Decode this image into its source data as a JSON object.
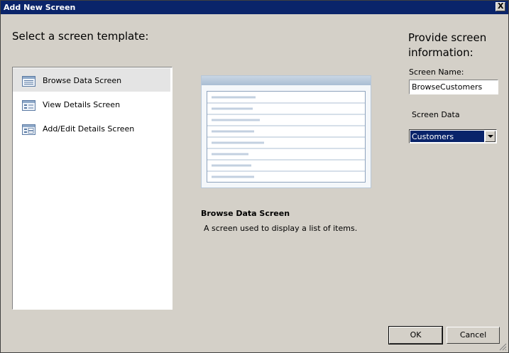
{
  "window": {
    "title": "Add New Screen",
    "close_label": "X"
  },
  "left": {
    "heading": "Select a screen template:",
    "templates": [
      {
        "label": "Browse Data Screen",
        "icon": "browse-data-template-icon",
        "selected": true
      },
      {
        "label": "View Details Screen",
        "icon": "view-details-template-icon",
        "selected": false
      },
      {
        "label": "Add/Edit Details Screen",
        "icon": "add-edit-details-template-icon",
        "selected": false
      }
    ]
  },
  "preview": {
    "title": "Browse Data Screen",
    "description": "A screen used to display a list of items.",
    "row_count": 8
  },
  "right": {
    "heading": "Provide screen information:",
    "screen_name_label": "Screen Name:",
    "screen_name_value": "BrowseCustomers",
    "screen_data_label": "Screen Data",
    "screen_data_value": "Customers"
  },
  "buttons": {
    "ok": "OK",
    "cancel": "Cancel"
  },
  "colors": {
    "titlebar": "#0a246a",
    "dialog_bg": "#d4d0c8",
    "selection": "#0a246a",
    "preview_border": "#b7c7d8"
  }
}
